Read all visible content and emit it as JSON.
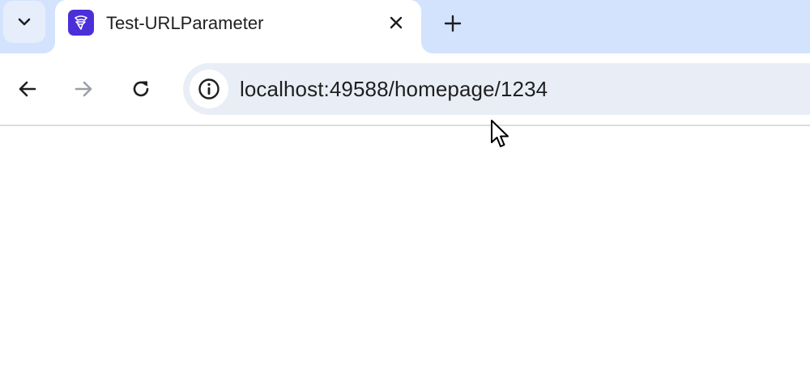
{
  "tabs": [
    {
      "title": "Test-URLParameter",
      "active": true,
      "favicon": "app-logo-icon"
    }
  ],
  "tab_search": {
    "icon": "chevron-down-icon"
  },
  "new_tab": {
    "icon": "plus-icon"
  },
  "toolbar": {
    "back_icon": "arrow-left-icon",
    "forward_icon": "arrow-right-icon",
    "reload_icon": "reload-icon",
    "site_info_icon": "info-icon"
  },
  "address_bar": {
    "url": "localhost:49588/homepage/1234"
  },
  "colors": {
    "tabstrip_bg": "#d3e3fd",
    "omnibox_bg": "#e9eef6",
    "favicon_bg": "#4b2fd9",
    "forward_disabled": "#9aa0a6"
  }
}
